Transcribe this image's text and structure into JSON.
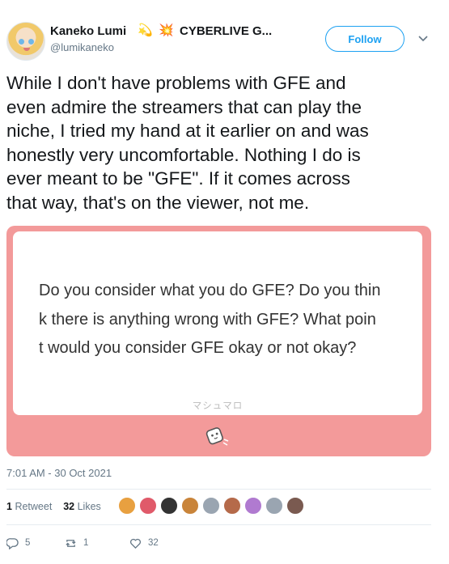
{
  "author": {
    "display_name": "Kaneko Lumi",
    "name_emoji_1": "💫",
    "name_emoji_2": "💥",
    "name_suffix": "CYBERLIVE G...",
    "handle": "@lumikaneko",
    "follow_label": "Follow"
  },
  "tweet": {
    "lines": [
      "While I don't have problems with GFE and",
      "even admire the streamers that can play the",
      "niche, I tried my hand at it earlier on and was",
      "honestly very uncomfortable. Nothing I do is",
      "ever meant to be \"GFE\". If it comes across",
      "that way, that's on the viewer, not me."
    ],
    "timestamp": "7:01 AM - 30 Oct 2021"
  },
  "card": {
    "question_lines": [
      "Do you consider what you do GFE? Do you thin",
      "k there is anything wrong with GFE? What poin",
      "t would you consider GFE okay or not okay?"
    ],
    "service_label": "マシュマロ",
    "icon": "marshmallow-icon",
    "background": "#f39a9a"
  },
  "stats": {
    "retweet_count": "1",
    "retweet_label": "Retweet",
    "like_count": "32",
    "like_label": "Likes"
  },
  "likers": [
    {
      "icon": "liker-avatar",
      "color": "#e8a040"
    },
    {
      "icon": "liker-avatar",
      "color": "#e05a6a"
    },
    {
      "icon": "liker-avatar",
      "color": "#333333"
    },
    {
      "icon": "liker-avatar",
      "color": "#c9843a"
    },
    {
      "icon": "liker-avatar",
      "color": "#9aa5b1"
    },
    {
      "icon": "liker-avatar",
      "color": "#b56a4a"
    },
    {
      "icon": "liker-avatar",
      "color": "#b07ad0"
    },
    {
      "icon": "liker-avatar",
      "color": "#9aa5b1"
    },
    {
      "icon": "liker-avatar",
      "color": "#7a5a50"
    }
  ],
  "actions": {
    "reply_count": "5",
    "retweet_count": "1",
    "like_count": "32"
  },
  "colors": {
    "accent": "#1da1f2",
    "muted": "#657786"
  }
}
